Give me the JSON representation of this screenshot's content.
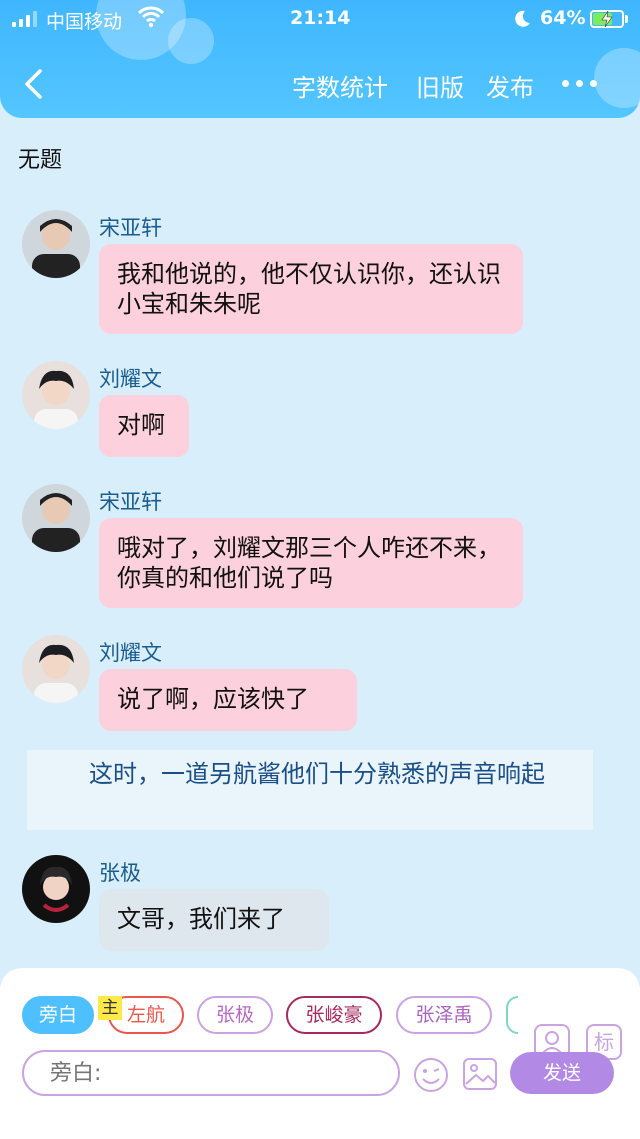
{
  "status_bar": {
    "carrier": "中国移动",
    "time": "21:14",
    "battery": "64%",
    "icons": [
      "signal-icon",
      "wifi-icon",
      "moon-icon",
      "battery-icon"
    ]
  },
  "nav": {
    "back_icon": "chevron-left-icon",
    "word_count": "字数统计",
    "old_version": "旧版",
    "publish": "发布",
    "more_icon": "more-icon"
  },
  "title": "无题",
  "messages": [
    {
      "name": "宋亚轩",
      "text": "我和他说的，他不仅认识你，还认识小宝和朱朱呢",
      "style": "pink"
    },
    {
      "name": "刘耀文",
      "text": "对啊",
      "style": "pink"
    },
    {
      "name": "宋亚轩",
      "text": "哦对了，刘耀文那三个人咋还不来，你真的和他们说了吗",
      "style": "pink"
    },
    {
      "name": "刘耀文",
      "text": "说了啊，应该快了",
      "style": "pink"
    },
    {
      "name": "张极",
      "text": "文哥，我们来了",
      "style": "gray"
    }
  ],
  "narration": "这时，一道另航酱他们十分熟悉的声音响起",
  "input_bar": {
    "chips": [
      {
        "label": "旁白",
        "active": true
      },
      {
        "label": "左航",
        "color": "#e9574a"
      },
      {
        "label": "张极",
        "color": "#b66ac2"
      },
      {
        "label": "张峻豪",
        "color": "#a6295f"
      },
      {
        "label": "张泽禹",
        "color": "#a765bd"
      }
    ],
    "main_badge": "主",
    "tag_label": "标",
    "placeholder": "旁白:",
    "send": "发送"
  }
}
